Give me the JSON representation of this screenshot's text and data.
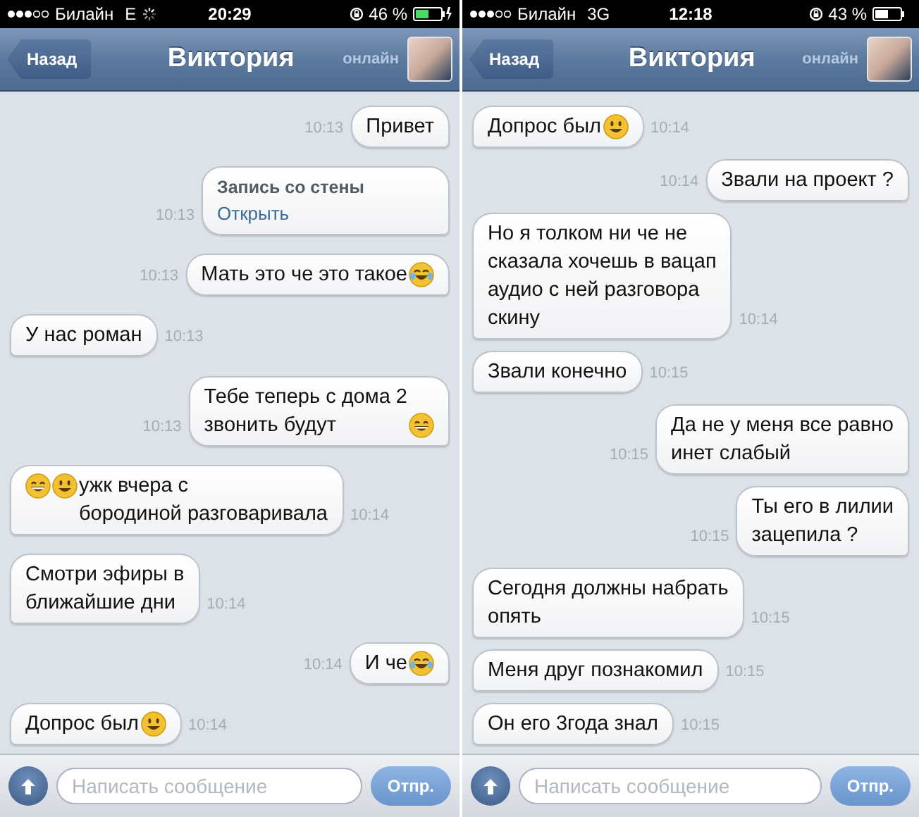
{
  "screens": [
    {
      "status_bar": {
        "carrier": "Билайн",
        "network": "E",
        "loading": true,
        "time": "20:29",
        "battery": "46 %",
        "charging": true
      },
      "nav": {
        "back": "Назад",
        "title": "Виктория",
        "status": "онлайн"
      },
      "messages": [
        {
          "kind": "text",
          "outgoing": true,
          "time": "10:13",
          "parts": [
            {
              "kind": "text",
              "text": "Привет"
            }
          ]
        },
        {
          "kind": "wall",
          "outgoing": true,
          "time": "10:13",
          "title": "Запись со стены",
          "link": "Открыть"
        },
        {
          "kind": "text",
          "outgoing": true,
          "time": "10:13",
          "parts": [
            {
              "kind": "text",
              "text": "Мать это че это такое"
            },
            {
              "kind": "laugh"
            }
          ]
        },
        {
          "kind": "text",
          "outgoing": false,
          "time": "10:13",
          "parts": [
            {
              "kind": "text",
              "text": "У нас роман"
            }
          ]
        },
        {
          "kind": "text",
          "outgoing": true,
          "time": "10:13",
          "parts": [
            {
              "kind": "text",
              "text": "Тебе теперь с дома 2\nзвонить будут"
            },
            {
              "kind": "grin"
            }
          ]
        },
        {
          "kind": "text",
          "outgoing": false,
          "time": "10:14",
          "parts": [
            {
              "kind": "grin"
            },
            {
              "kind": "smile"
            },
            {
              "kind": "text",
              "text": "ужк вчера с\nбородиной разговаривала"
            }
          ]
        },
        {
          "kind": "text",
          "outgoing": false,
          "time": "10:14",
          "parts": [
            {
              "kind": "text",
              "text": "Смотри эфиры в\nближайшие дни"
            }
          ]
        },
        {
          "kind": "text",
          "outgoing": true,
          "time": "10:14",
          "parts": [
            {
              "kind": "text",
              "text": "И че"
            },
            {
              "kind": "laugh"
            }
          ]
        },
        {
          "kind": "text",
          "outgoing": false,
          "time": "10:14",
          "parts": [
            {
              "kind": "text",
              "text": "Допрос был"
            },
            {
              "kind": "smile"
            }
          ]
        }
      ],
      "input": {
        "placeholder": "Написать сообщение",
        "send": "Отпр."
      }
    },
    {
      "status_bar": {
        "carrier": "Билайн",
        "network": "3G",
        "loading": false,
        "time": "12:18",
        "battery": "43 %",
        "charging": false
      },
      "nav": {
        "back": "Назад",
        "title": "Виктория",
        "status": "онлайн"
      },
      "messages": [
        {
          "kind": "text",
          "outgoing": false,
          "time": "10:14",
          "parts": [
            {
              "kind": "text",
              "text": "Допрос был"
            },
            {
              "kind": "smile"
            }
          ]
        },
        {
          "kind": "text",
          "outgoing": true,
          "time": "10:14",
          "parts": [
            {
              "kind": "text",
              "text": "Звали на проект ?"
            }
          ]
        },
        {
          "kind": "text",
          "outgoing": false,
          "time": "10:14",
          "parts": [
            {
              "kind": "text",
              "text": "Но я толком ни че не\nсказала хочешь в вацап\nаудио с ней разговора\nскину"
            }
          ]
        },
        {
          "kind": "text",
          "outgoing": false,
          "time": "10:15",
          "parts": [
            {
              "kind": "text",
              "text": "Звали конечно"
            }
          ]
        },
        {
          "kind": "text",
          "outgoing": true,
          "time": "10:15",
          "parts": [
            {
              "kind": "text",
              "text": "Да не у меня все равно\nинет слабый"
            }
          ]
        },
        {
          "kind": "text",
          "outgoing": true,
          "time": "10:15",
          "parts": [
            {
              "kind": "text",
              "text": "Ты его в лилии\nзацепила ?"
            }
          ]
        },
        {
          "kind": "text",
          "outgoing": false,
          "time": "10:15",
          "parts": [
            {
              "kind": "text",
              "text": "Сегодня должны набрать\nопять"
            }
          ]
        },
        {
          "kind": "text",
          "outgoing": false,
          "time": "10:15",
          "parts": [
            {
              "kind": "text",
              "text": "Меня друг познакомил"
            }
          ]
        },
        {
          "kind": "text",
          "outgoing": false,
          "time": "10:15",
          "parts": [
            {
              "kind": "text",
              "text": "Он его 3года знал"
            }
          ]
        }
      ],
      "input": {
        "placeholder": "Написать сообщение",
        "send": "Отпр."
      }
    }
  ]
}
